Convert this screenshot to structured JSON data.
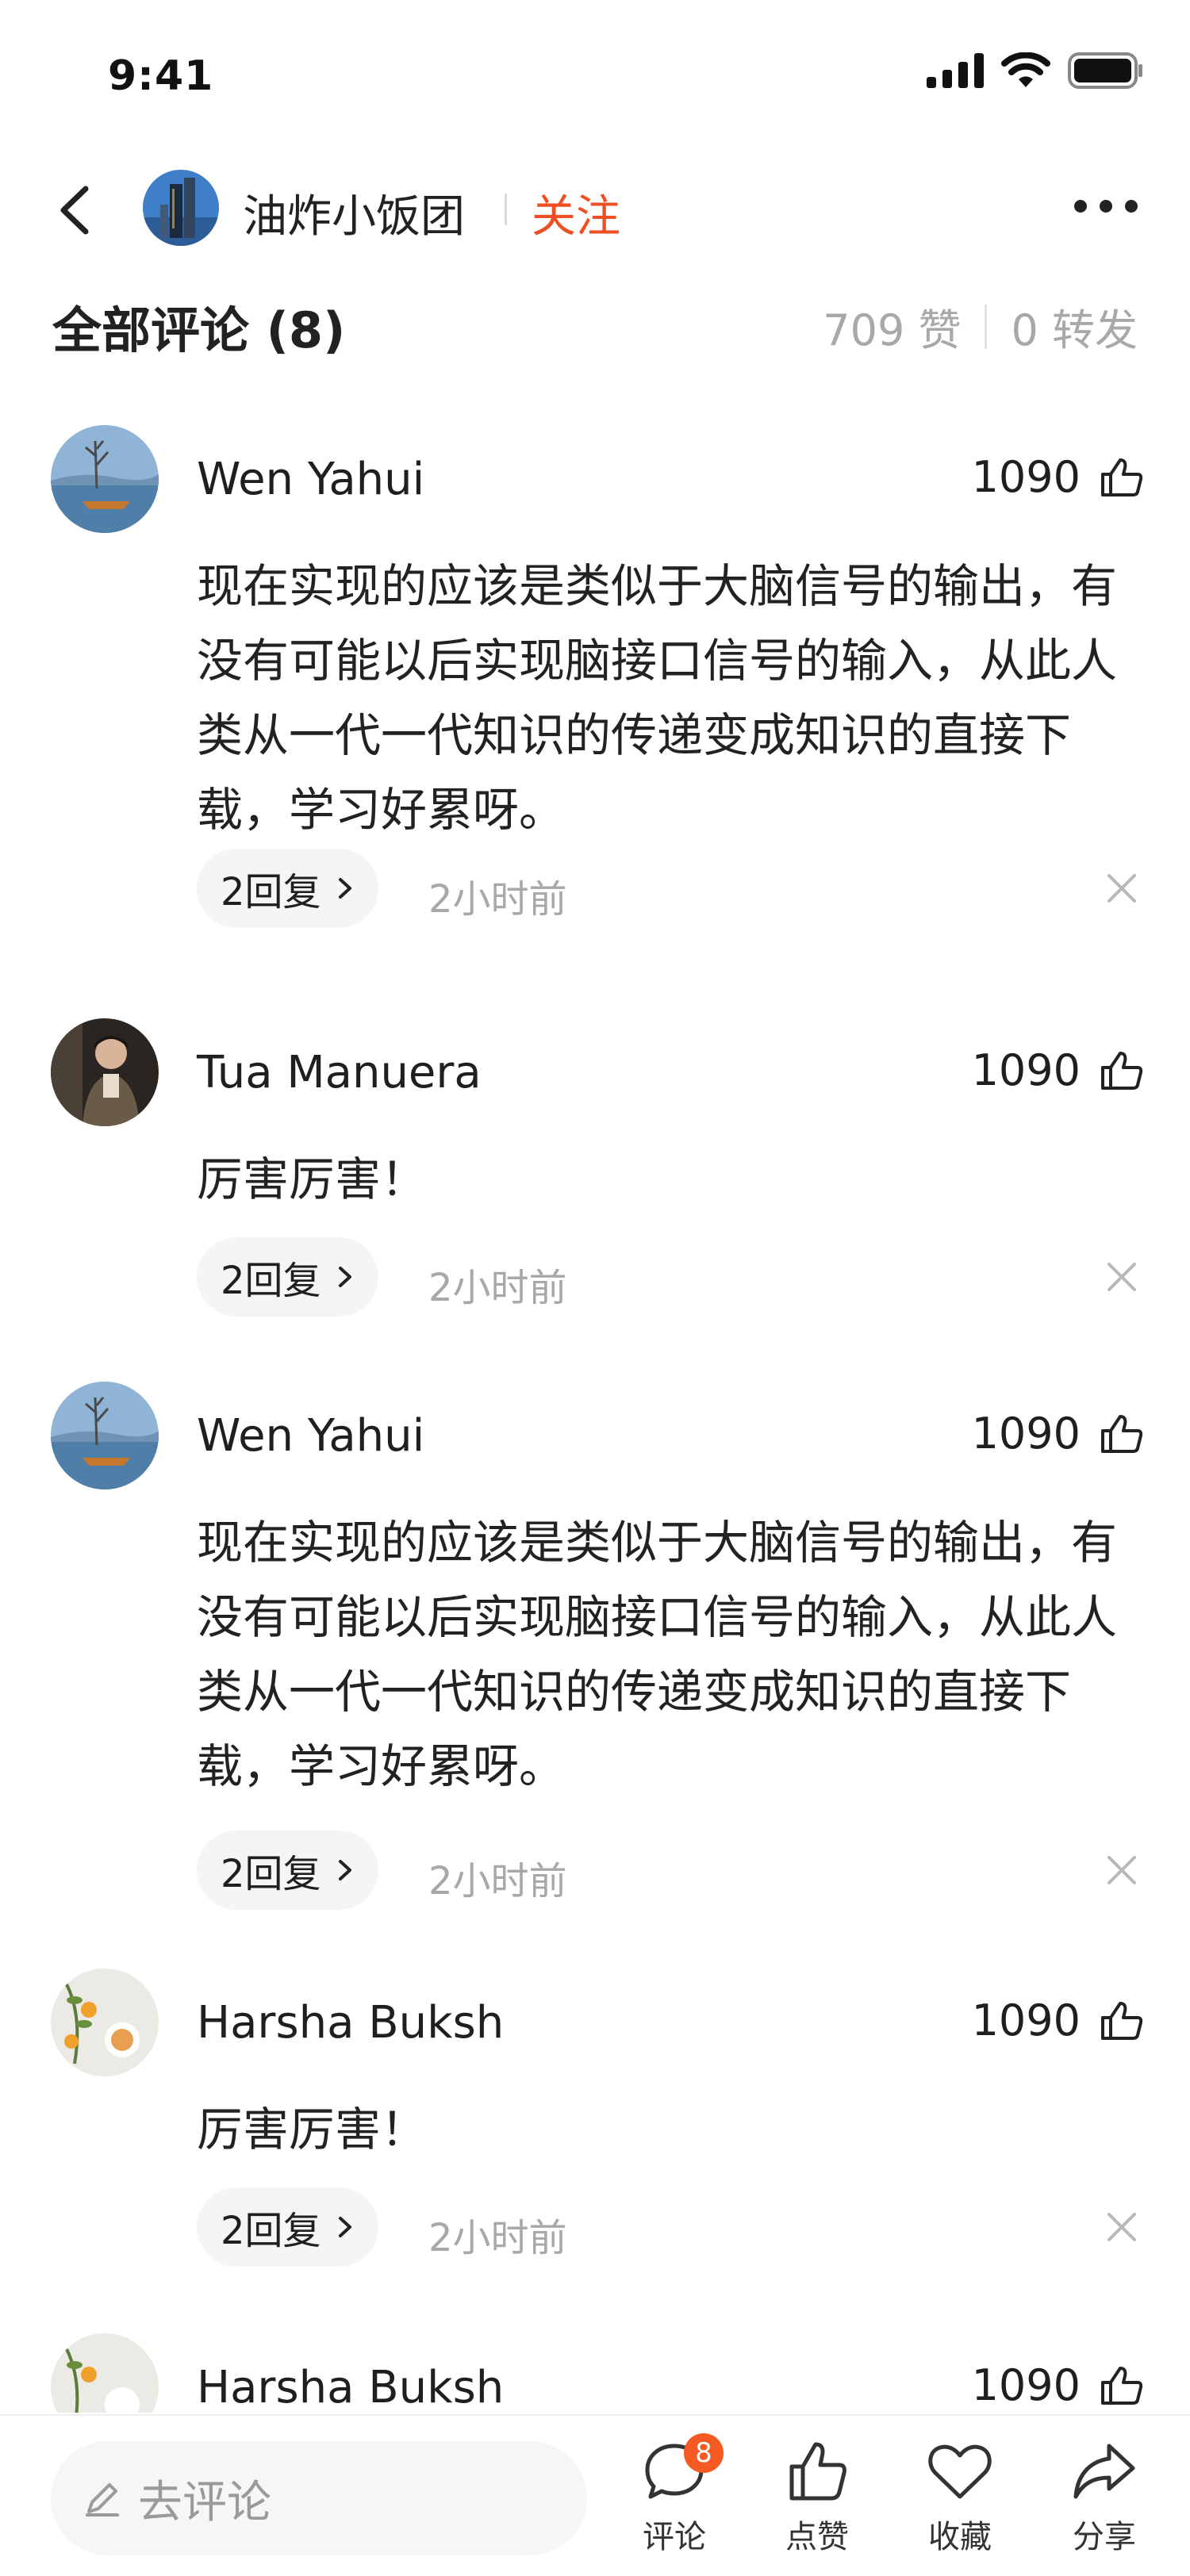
{
  "status_bar": {
    "time": "9:41"
  },
  "nav": {
    "username": "油炸小饭团",
    "follow_label": "关注"
  },
  "header": {
    "title": "全部评论 (8)",
    "likes": "709 赞",
    "reposts": "0 转发"
  },
  "comments": [
    {
      "name": "Wen Yahui",
      "likes": "1090",
      "text": "现在实现的应该是类似于大脑信号的输出，有没有可能以后实现脑接口信号的输入，从此人类从一代一代知识的传递变成知识的直接下载，学习好累呀。",
      "replies": "2回复",
      "time": "2小时前"
    },
    {
      "name": "Tua Manuera",
      "likes": "1090",
      "text": "厉害厉害！",
      "replies": "2回复",
      "time": "2小时前"
    },
    {
      "name": "Wen Yahui",
      "likes": "1090",
      "text": "现在实现的应该是类似于大脑信号的输出，有没有可能以后实现脑接口信号的输入，从此人类从一代一代知识的传递变成知识的直接下载，学习好累呀。",
      "replies": "2回复",
      "time": "2小时前"
    },
    {
      "name": "Harsha Buksh",
      "likes": "1090",
      "text": "厉害厉害！",
      "replies": "2回复",
      "time": "2小时前"
    },
    {
      "name": "Harsha Buksh",
      "likes": "1090"
    }
  ],
  "bottom_bar": {
    "input_placeholder": "去评论",
    "comment_label": "评论",
    "comment_badge": "8",
    "like_label": "点赞",
    "favorite_label": "收藏",
    "share_label": "分享"
  },
  "colors": {
    "accent": "#f04e23",
    "badge": "#f55a22",
    "muted": "#a8a8a8"
  }
}
